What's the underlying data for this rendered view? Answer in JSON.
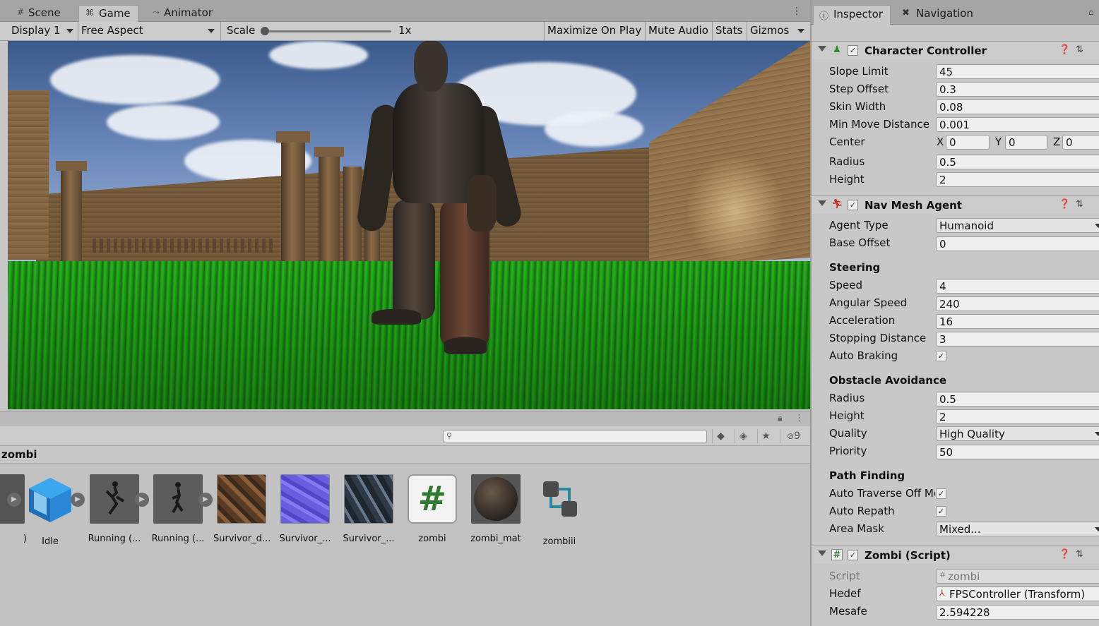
{
  "game_tabs": [
    {
      "label": "Scene",
      "icon": "scene-grid-icon"
    },
    {
      "label": "Game",
      "icon": "gamepad-icon"
    },
    {
      "label": "Animator",
      "icon": "animator-icon"
    }
  ],
  "game_toolbar": {
    "display": "Display 1",
    "aspect": "Free Aspect",
    "scale_label": "Scale",
    "scale_value": "1x",
    "maximize": "Maximize On Play",
    "mute": "Mute Audio",
    "stats": "Stats",
    "gizmos": "Gizmos"
  },
  "project": {
    "hidden_count": "9",
    "breadcrumb": "zombi",
    "assets": [
      {
        "label": ")",
        "icon": "animation-clip-icon"
      },
      {
        "label": "Idle",
        "icon": "prefab-cube-icon"
      },
      {
        "label": "Running (...",
        "icon": "animation-clip-icon"
      },
      {
        "label": "Running (...",
        "icon": "animation-clip-icon"
      },
      {
        "label": "Survivor_d...",
        "icon": "texture-icon"
      },
      {
        "label": "Survivor_...",
        "icon": "normal-map-icon"
      },
      {
        "label": "Survivor_...",
        "icon": "texture-icon"
      },
      {
        "label": "zombi",
        "icon": "csharp-script-icon"
      },
      {
        "label": "zombi_mat",
        "icon": "material-icon"
      },
      {
        "label": "zombiii",
        "icon": "animator-controller-icon"
      }
    ]
  },
  "inspector": {
    "tabs": [
      {
        "label": "Inspector",
        "icon": "info-icon"
      },
      {
        "label": "Navigation",
        "icon": "navigation-icon"
      }
    ],
    "character_controller": {
      "title": "Character Controller",
      "slope_limit_label": "Slope Limit",
      "slope_limit": "45",
      "step_offset_label": "Step Offset",
      "step_offset": "0.3",
      "skin_width_label": "Skin Width",
      "skin_width": "0.08",
      "min_move_label": "Min Move Distance",
      "min_move": "0.001",
      "center_label": "Center",
      "center_x": "0",
      "center_y": "0",
      "center_z": "0",
      "x_label": "X",
      "y_label": "Y",
      "z_label": "Z",
      "radius_label": "Radius",
      "radius": "0.5",
      "height_label": "Height",
      "height": "2"
    },
    "nav_mesh_agent": {
      "title": "Nav Mesh Agent",
      "agent_type_label": "Agent Type",
      "agent_type": "Humanoid",
      "base_offset_label": "Base Offset",
      "base_offset": "0",
      "steering_label": "Steering",
      "speed_label": "Speed",
      "speed": "4",
      "angular_speed_label": "Angular Speed",
      "angular_speed": "240",
      "acceleration_label": "Acceleration",
      "acceleration": "16",
      "stopping_label": "Stopping Distance",
      "stopping": "3",
      "auto_braking_label": "Auto Braking",
      "obstacle_label": "Obstacle Avoidance",
      "radius_label": "Radius",
      "radius": "0.5",
      "height_label": "Height",
      "height": "2",
      "quality_label": "Quality",
      "quality": "High Quality",
      "priority_label": "Priority",
      "priority": "50",
      "path_label": "Path Finding",
      "auto_traverse_label": "Auto Traverse Off Me",
      "auto_repath_label": "Auto Repath",
      "area_mask_label": "Area Mask",
      "area_mask": "Mixed..."
    },
    "zombi_script": {
      "title": "Zombi (Script)",
      "script_label": "Script",
      "script": "zombi",
      "hedef_label": "Hedef",
      "hedef": "FPSController (Transform)",
      "mesafe_label": "Mesafe",
      "mesafe": "2.594228"
    },
    "checkmark": "✓"
  }
}
